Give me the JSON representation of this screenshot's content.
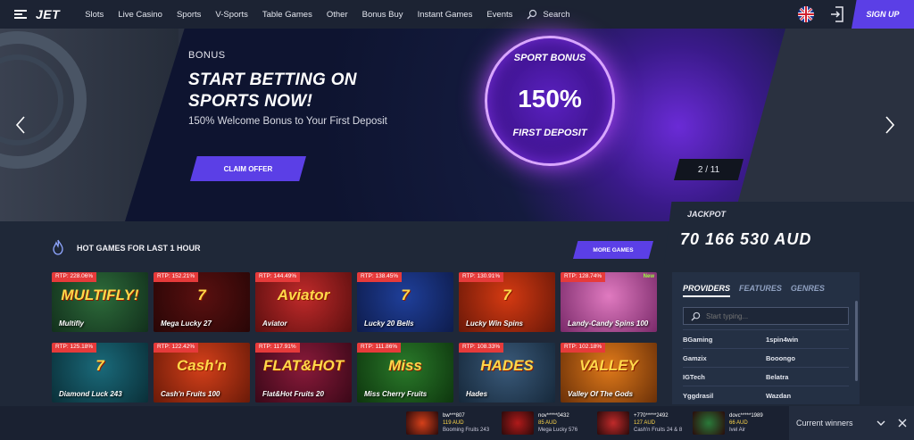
{
  "header": {
    "logo": "JET",
    "nav": [
      "Slots",
      "Live Casino",
      "Sports",
      "V-Sports",
      "Table Games",
      "Other",
      "Bonus Buy",
      "Instant Games",
      "Events"
    ],
    "search_label": "Search",
    "signup_label": "SIGN UP"
  },
  "banner": {
    "subtitle": "BONUS",
    "title": "START BETTING ON SPORTS NOW!",
    "description": "150% Welcome Bonus to Your First Deposit",
    "cta_label": "CLAIM OFFER",
    "badge_top": "SPORT BONUS",
    "badge_value": "150%",
    "badge_bottom": "FIRST DEPOSIT",
    "counter": "2 / 11"
  },
  "jackpot": {
    "label": "JACKPOT",
    "value": "70 166 530 AUD"
  },
  "hot_games": {
    "title": "HOT GAMES FOR LAST 1 HOUR",
    "more_label": "MORE GAMES",
    "games": [
      {
        "name": "Multifly",
        "rtp": "RTP: 228.06%",
        "logo": "MULTIFLY!",
        "bg": "#2d6b3a",
        "bg2": "#12301c"
      },
      {
        "name": "Mega Lucky 27",
        "rtp": "RTP: 152.21%",
        "logo": "7",
        "bg": "#5a1010",
        "bg2": "#280606"
      },
      {
        "name": "Aviator",
        "rtp": "RTP: 144.49%",
        "logo": "Aviator",
        "bg": "#c02a2a",
        "bg2": "#5c0f0f"
      },
      {
        "name": "Lucky 20 Bells",
        "rtp": "RTP: 138.45%",
        "logo": "7",
        "bg": "#1f3f9a",
        "bg2": "#0e1c4c"
      },
      {
        "name": "Lucky Win Spins",
        "rtp": "RTP: 130.91%",
        "logo": "7",
        "bg": "#d53a12",
        "bg2": "#6a1808"
      },
      {
        "name": "Landy-Candy Spins 100",
        "rtp": "RTP: 128.74%",
        "logo": "",
        "bg": "#e07ac0",
        "bg2": "#7a2a6a",
        "new": "New"
      },
      {
        "name": "Diamond Luck 243",
        "rtp": "RTP: 125.18%",
        "logo": "7",
        "bg": "#1a6a7a",
        "bg2": "#0a2f38"
      },
      {
        "name": "Cash'n Fruits 100",
        "rtp": "RTP: 122.42%",
        "logo": "Cash'n",
        "bg": "#d5401a",
        "bg2": "#6a1a08"
      },
      {
        "name": "Flat&Hot Fruits 20",
        "rtp": "RTP: 117.91%",
        "logo": "FLAT&HOT",
        "bg": "#8a1a3a",
        "bg2": "#3a0818"
      },
      {
        "name": "Miss Cherry Fruits",
        "rtp": "RTP: 111.86%",
        "logo": "Miss",
        "bg": "#2a7a2a",
        "bg2": "#0e360e"
      },
      {
        "name": "Hades",
        "rtp": "RTP: 108.33%",
        "logo": "HADES",
        "bg": "#3a5a7a",
        "bg2": "#16283a"
      },
      {
        "name": "Valley Of The Gods",
        "rtp": "RTP: 102.18%",
        "logo": "VALLEY",
        "bg": "#e07a1a",
        "bg2": "#6a3008"
      }
    ]
  },
  "providers": {
    "tabs": [
      "PROVIDERS",
      "FEATURES",
      "GENRES"
    ],
    "search_placeholder": "Start typing...",
    "items": [
      [
        "BGaming",
        "1spin4win"
      ],
      [
        "Gamzix",
        "Booongo"
      ],
      [
        "IGTech",
        "Belatra"
      ],
      [
        "Yggdrasil",
        "Wazdan"
      ]
    ]
  },
  "winners": {
    "label": "Current winners",
    "items": [
      {
        "user": "bw***807",
        "amount": "119 AUD",
        "game": "Booming Fruits 243",
        "bg": "#d5401a"
      },
      {
        "user": "nov*****0432",
        "amount": "85 AUD",
        "game": "Mega Lucky 576",
        "bg": "#b01a1a"
      },
      {
        "user": "+770*****2492",
        "amount": "127 AUD",
        "game": "Cash'n Fruits 24 & 8",
        "bg": "#c02a2a"
      },
      {
        "user": "dovc*****1989",
        "amount": "66 AUD",
        "game": "Ivel Air",
        "bg": "#2a7a3a"
      }
    ]
  }
}
